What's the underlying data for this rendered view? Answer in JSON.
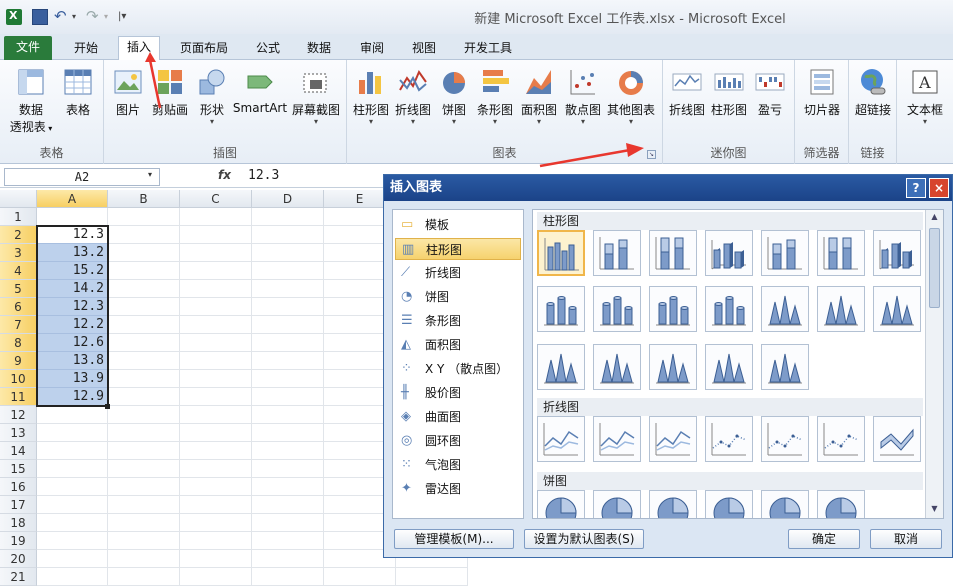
{
  "app": {
    "title": "新建 Microsoft Excel 工作表.xlsx  -  Microsoft Excel"
  },
  "tabs": [
    "文件",
    "开始",
    "插入",
    "页面布局",
    "公式",
    "数据",
    "审阅",
    "视图",
    "开发工具"
  ],
  "active_tab": "插入",
  "ribbon": {
    "groups": {
      "tables": "表格",
      "illustrations": "插图",
      "charts": "图表",
      "sparklines": "迷你图",
      "filter": "筛选器",
      "links": "链接"
    },
    "buttons": {
      "pivot": "数据\n透视表",
      "pivot_l1": "数据",
      "pivot_l2": "透视表",
      "table": "表格",
      "picture": "图片",
      "clipart": "剪贴画",
      "shapes": "形状",
      "smartart": "SmartArt",
      "screenshot": "屏幕截图",
      "column": "柱形图",
      "line": "折线图",
      "pie": "饼图",
      "bar": "条形图",
      "area": "面积图",
      "scatter": "散点图",
      "other": "其他图表",
      "spark_line": "折线图",
      "spark_column": "柱形图",
      "spark_winloss": "盈亏",
      "slicer": "切片器",
      "hyperlink": "超链接",
      "textbox": "文本框"
    }
  },
  "formula_bar": {
    "name_box": "A2",
    "fx": "fx",
    "value": "12.3"
  },
  "sheet": {
    "columns": [
      "A",
      "B",
      "C",
      "D",
      "E"
    ],
    "rows": [
      "1",
      "2",
      "3",
      "4",
      "5",
      "6",
      "7",
      "8",
      "9",
      "10",
      "11",
      "12",
      "13",
      "14",
      "15",
      "16",
      "17",
      "18",
      "19",
      "20",
      "21"
    ],
    "colA_values": [
      "",
      "12.3",
      "13.2",
      "15.2",
      "14.2",
      "12.3",
      "12.2",
      "12.6",
      "13.8",
      "13.9",
      "12.9"
    ]
  },
  "dialog": {
    "title": "插入图表",
    "help": "?",
    "close": "×",
    "categories": [
      "模板",
      "柱形图",
      "折线图",
      "饼图",
      "条形图",
      "面积图",
      "X Y （散点图）",
      "股价图",
      "曲面图",
      "圆环图",
      "气泡图",
      "雷达图"
    ],
    "selected_category": "柱形图",
    "sections": {
      "column": "柱形图",
      "line": "折线图",
      "pie": "饼图"
    },
    "buttons": {
      "manage": "管理模板(M)...",
      "set_default": "设置为默认图表(S)",
      "ok": "确定",
      "cancel": "取消"
    }
  },
  "colors": {
    "file_tab": "#2a7b3b",
    "dialog_title": "#1b4388",
    "selection": "#bdd1ec",
    "arrow": "#e8372e"
  }
}
